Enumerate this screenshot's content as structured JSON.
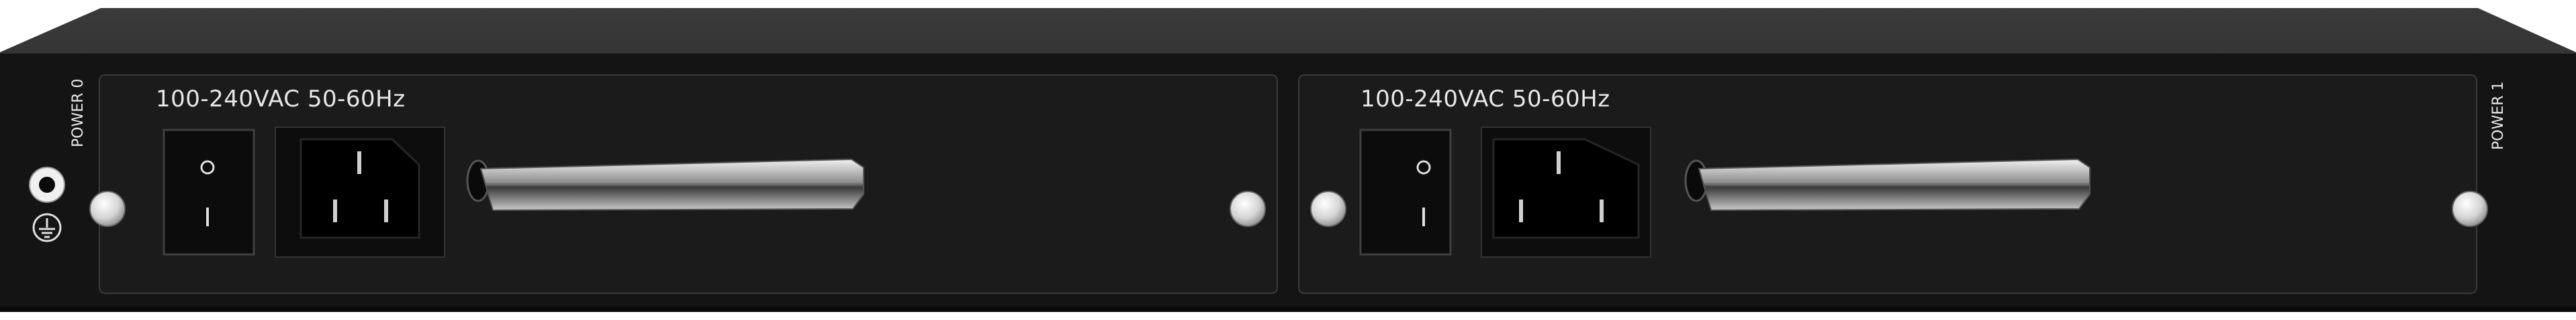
{
  "labels": {
    "power_0": "POWER 0",
    "power_1": "POWER 1"
  },
  "psu_slots": [
    {
      "rating": "100-240VAC 50-60Hz",
      "switch_on_symbol": "I",
      "switch_off_symbol": "O"
    },
    {
      "rating": "100-240VAC 50-60Hz",
      "switch_on_symbol": "I",
      "switch_off_symbol": "O"
    }
  ],
  "icons": {
    "ground": "ground-terminal-icon",
    "ground_screw": "ground-screw-icon"
  },
  "colors": {
    "chassis": "#141414",
    "panel": "#1b1b1b",
    "handle": "#bdbdbd",
    "label_text": "#e8e8e8"
  }
}
